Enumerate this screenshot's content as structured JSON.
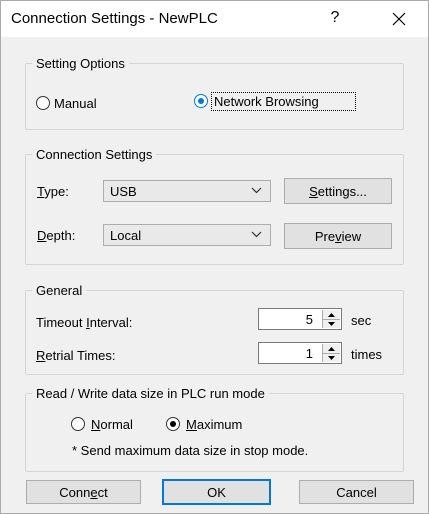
{
  "window": {
    "title": "Connection Settings - NewPLC",
    "help": "?",
    "close": "×"
  },
  "setting_options": {
    "legend": "Setting Options",
    "manual_label": "Manual",
    "network_label": "Network Browsing",
    "selected": "Network Browsing"
  },
  "connection_settings": {
    "legend": "Connection Settings",
    "type_label": {
      "pre": "",
      "key": "T",
      "post": "ype:"
    },
    "type_value": "USB",
    "depth_label": {
      "pre": "",
      "key": "D",
      "post": "epth:"
    },
    "depth_value": "Local",
    "settings_button": {
      "pre": "",
      "key": "S",
      "post": "ettings..."
    },
    "preview_button": {
      "pre": "Pre",
      "key": "v",
      "post": "iew"
    }
  },
  "general": {
    "legend": "General",
    "timeout_label": {
      "pre": "Timeout ",
      "key": "I",
      "post": "nterval:"
    },
    "timeout_value": "5",
    "timeout_unit": "sec",
    "retrial_label": {
      "pre": "",
      "key": "R",
      "post": "etrial Times:"
    },
    "retrial_value": "1",
    "retrial_unit": "times"
  },
  "rw_size": {
    "legend": "Read / Write data size in PLC run mode",
    "normal_label": {
      "pre": "",
      "key": "N",
      "post": "ormal"
    },
    "maximum_label": {
      "pre": "",
      "key": "M",
      "post": "aximum"
    },
    "selected": "Maximum",
    "note": "* Send maximum data size in stop mode."
  },
  "buttons": {
    "connect": {
      "pre": "Conn",
      "key": "e",
      "post": "ct"
    },
    "ok": "OK",
    "cancel": "Cancel"
  }
}
